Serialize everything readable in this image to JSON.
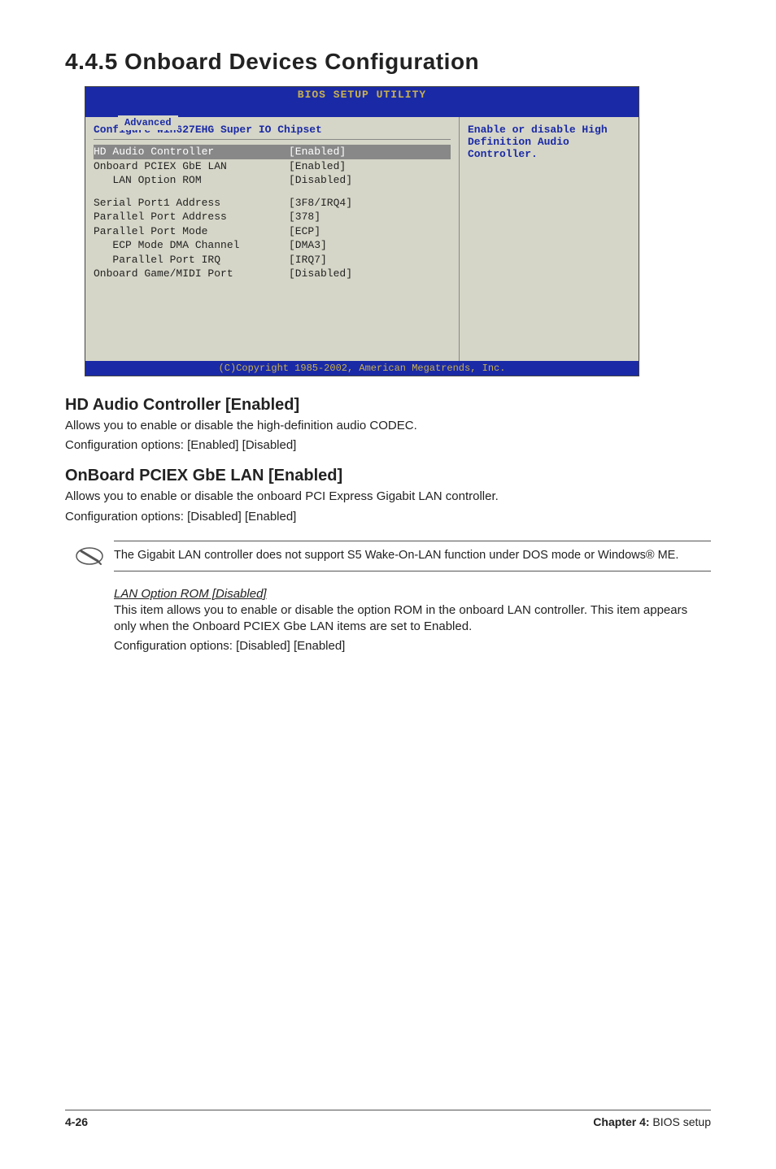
{
  "heading": "4.4.5   Onboard Devices Configuration",
  "bios": {
    "title": "BIOS SETUP UTILITY",
    "tab": "Advanced",
    "panel_title": "Configure Win627EHG Super IO Chipset",
    "rows": [
      {
        "label": "HD Audio Controller",
        "value": "[Enabled]",
        "selected": true
      },
      {
        "label": "Onboard PCIEX GbE LAN",
        "value": "[Enabled]"
      },
      {
        "label": "   LAN Option ROM",
        "value": "[Disabled]"
      }
    ],
    "rows2": [
      {
        "label": "Serial Port1 Address",
        "value": "[3F8/IRQ4]"
      },
      {
        "label": "Parallel Port Address",
        "value": "[378]"
      },
      {
        "label": "Parallel Port Mode",
        "value": "[ECP]"
      },
      {
        "label": "   ECP Mode DMA Channel",
        "value": "[DMA3]"
      },
      {
        "label": "   Parallel Port IRQ",
        "value": "[IRQ7]"
      },
      {
        "label": "Onboard Game/MIDI Port",
        "value": "[Disabled]"
      }
    ],
    "help": "Enable or disable High Definition Audio Controller.",
    "footer": "(C)Copyright 1985-2002, American Megatrends, Inc."
  },
  "sections": {
    "s1_title": "HD Audio Controller [Enabled]",
    "s1_p1": "Allows you to enable or disable the high-definition audio CODEC.",
    "s1_p2": "Configuration options: [Enabled] [Disabled]",
    "s2_title": "OnBoard PCIEX GbE LAN [Enabled]",
    "s2_p1": "Allows you to enable or disable the onboard PCI Express Gigabit LAN controller.",
    "s2_p2": "Configuration options: [Disabled] [Enabled]",
    "note": "The Gigabit LAN controller does not support S5 Wake-On-LAN function under DOS mode or Windows® ME.",
    "opt_title": "LAN Option ROM [Disabled]",
    "opt_p1": "This item allows you to enable or disable the option ROM in the onboard LAN controller. This item appears only when the Onboard PCIEX Gbe LAN items are set to Enabled.",
    "opt_p2": "Configuration options: [Disabled] [Enabled]"
  },
  "footer": {
    "page": "4-26",
    "chapter_label": "Chapter 4: ",
    "chapter_text": "BIOS setup"
  }
}
